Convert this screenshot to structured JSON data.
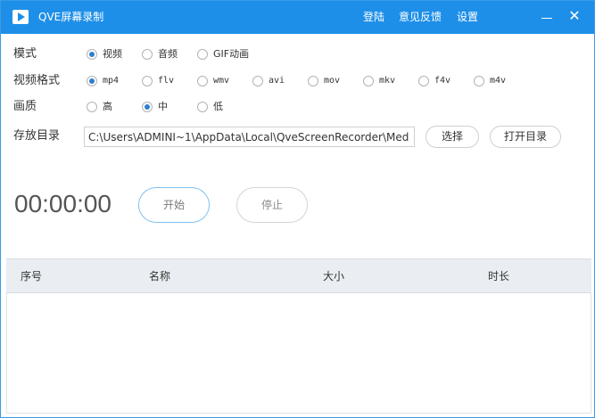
{
  "titlebar": {
    "app_icon": "play-icon",
    "title": "QVE屏幕录制",
    "menu": {
      "login": "登陆",
      "feedback": "意见反馈",
      "settings": "设置"
    },
    "minimize_icon": "minimize-icon",
    "close_icon": "close-icon",
    "close_glyph": "✕"
  },
  "mode": {
    "label": "模式",
    "options": [
      {
        "label": "视频",
        "checked": true
      },
      {
        "label": "音频",
        "checked": false
      },
      {
        "label": "GIF动画",
        "checked": false
      }
    ]
  },
  "format": {
    "label": "视频格式",
    "options": [
      {
        "label": "mp4",
        "checked": true
      },
      {
        "label": "flv",
        "checked": false
      },
      {
        "label": "wmv",
        "checked": false
      },
      {
        "label": "avi",
        "checked": false
      },
      {
        "label": "mov",
        "checked": false
      },
      {
        "label": "mkv",
        "checked": false
      },
      {
        "label": "f4v",
        "checked": false
      },
      {
        "label": "m4v",
        "checked": false
      }
    ]
  },
  "quality": {
    "label": "画质",
    "options": [
      {
        "label": "高",
        "checked": false
      },
      {
        "label": "中",
        "checked": true
      },
      {
        "label": "低",
        "checked": false
      }
    ]
  },
  "storage": {
    "label": "存放目录",
    "path": "C:\\Users\\ADMINI~1\\AppData\\Local\\QveScreenRecorder\\Med",
    "choose_button": "选择",
    "open_button": "打开目录"
  },
  "recorder": {
    "timer": "00:00:00",
    "start_button": "开始",
    "stop_button": "停止"
  },
  "table": {
    "columns": [
      "序号",
      "名称",
      "大小",
      "时长"
    ],
    "rows": []
  },
  "colors": {
    "titlebar": "#1e8fe8",
    "radio_checked": "#2f7fcd",
    "start_border": "#7fc1ee",
    "header_bg": "#eaeef2"
  }
}
